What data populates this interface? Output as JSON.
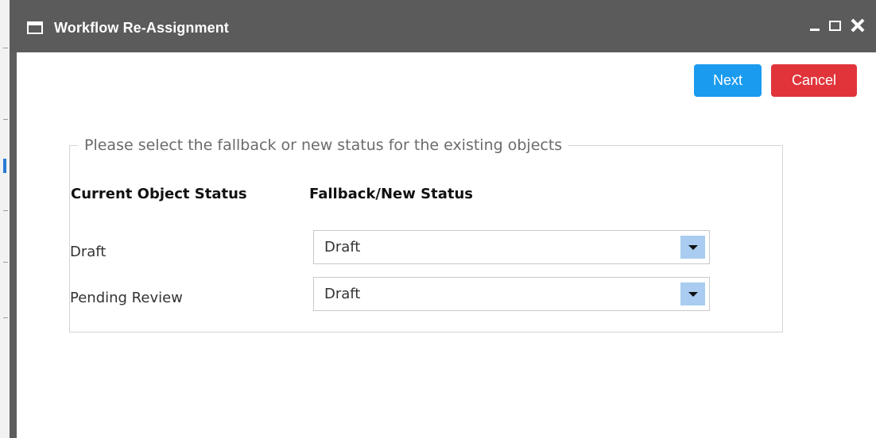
{
  "dialog": {
    "title": "Workflow Re-Assignment"
  },
  "buttons": {
    "next_label": "Next",
    "cancel_label": "Cancel"
  },
  "fieldset": {
    "legend": "Please select the fallback or new status for the existing objects",
    "column_headers": {
      "current": "Current Object Status",
      "fallback": "Fallback/New Status"
    },
    "rows": [
      {
        "current_status": "Draft",
        "fallback_status": "Draft"
      },
      {
        "current_status": "Pending Review",
        "fallback_status": "Draft"
      }
    ]
  },
  "colors": {
    "titlebar": "#5b5b5b",
    "next_button": "#1a9bf0",
    "cancel_button": "#e0343a",
    "dropdown_arrow_bg": "#a9ccf0"
  },
  "icons": {
    "window": "window-icon",
    "minimize": "minimize-icon",
    "maximize": "maximize-icon",
    "close": "close-icon",
    "dropdown": "chevron-down-icon"
  }
}
